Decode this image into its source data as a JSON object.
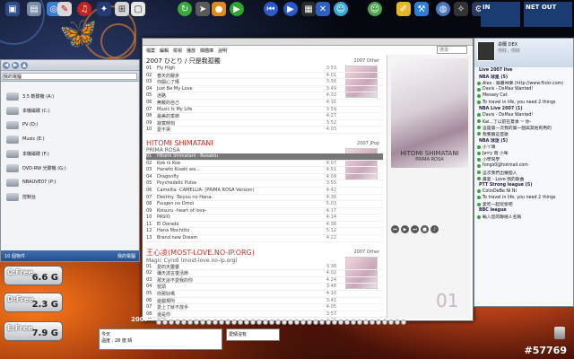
{
  "explorer": {
    "address": "我的電腦",
    "drives": [
      {
        "label": "3.5 軟碟機 (A:)"
      },
      {
        "label": "本機磁碟 (C:)"
      },
      {
        "label": "PV (D:)"
      },
      {
        "label": "Music (E:)"
      },
      {
        "label": "本機磁碟 (F:)"
      },
      {
        "label": "DVD-RW 光碟機 (G:)"
      },
      {
        "label": "NBAUVE07 (P:)"
      },
      {
        "label": "控制台"
      }
    ],
    "status_left": "10 個物件",
    "status_right": "我的電腦"
  },
  "gauges": [
    {
      "label": "C:Free",
      "value": "6.6 G"
    },
    {
      "label": "D:Free",
      "value": "2.3 G"
    },
    {
      "label": "E:Free",
      "value": "7.9 G"
    }
  ],
  "player": {
    "menu": [
      "檔案",
      "編輯",
      "檢視",
      "播放",
      "媒體庫",
      "說明"
    ],
    "search_placeholder": "搜尋",
    "albums": [
      {
        "title": "2007 ひとり / 只是我孤獨",
        "subtitle": "",
        "year": "2007 Other",
        "tracks": [
          {
            "n": "01",
            "title": "Fly High",
            "len": "3:53"
          },
          {
            "n": "02",
            "title": "春天的腳步",
            "len": "4:01"
          },
          {
            "n": "03",
            "title": "你開心了嗎",
            "len": "3:56"
          },
          {
            "n": "04",
            "title": "Just Be My Love",
            "len": "3:49"
          },
          {
            "n": "05",
            "title": "迷路",
            "len": "4:32"
          },
          {
            "n": "06",
            "title": "無敵的自己",
            "len": "4:15"
          },
          {
            "n": "07",
            "title": "Music Is My Life",
            "len": "3:59"
          },
          {
            "n": "08",
            "title": "最美的季節",
            "len": "4:27"
          },
          {
            "n": "09",
            "title": "寂寞時刻",
            "len": "3:52"
          },
          {
            "n": "10",
            "title": "愛不哭",
            "len": "4:03"
          }
        ]
      },
      {
        "title": "HITOMI SHIMATANI",
        "subtitle": "PRIMA ROSA",
        "year": "2007 JPop",
        "tracks": [
          {
            "n": "01",
            "title": "Hitomi Shimatani - Rosablu",
            "len": "4:28",
            "selected": true
          },
          {
            "n": "02",
            "title": "Koe ni Koe",
            "len": "4:07"
          },
          {
            "n": "03",
            "title": "Haneto Kiseki wa...",
            "len": "4:51"
          },
          {
            "n": "04",
            "title": "Dragonfly",
            "len": "4:09"
          },
          {
            "n": "05",
            "title": "Psychedelic Pulse",
            "len": "3:55"
          },
          {
            "n": "06",
            "title": "Camellia -CAMELLIA- (PRIMA ROSA Version)",
            "len": "4:42"
          },
          {
            "n": "07",
            "title": "Destiny -Taiyou no Hana-",
            "len": "4:36"
          },
          {
            "n": "08",
            "title": "Fuugen no Omoi",
            "len": "5:03"
          },
          {
            "n": "09",
            "title": "Koisuru -heart of love-",
            "len": "4:17"
          },
          {
            "n": "10",
            "title": "PASIO",
            "len": "4:14"
          },
          {
            "n": "11",
            "title": "El Dorado",
            "len": "4:38"
          },
          {
            "n": "12",
            "title": "Hana Mochitto",
            "len": "5:12"
          },
          {
            "n": "13",
            "title": "Brand new Dream",
            "len": "4:22"
          }
        ]
      },
      {
        "title": "王心凌(MOST-LOVE.NO-IP.ORG)",
        "subtitle": "Magic Cyndi (most-love.no-ip.org)",
        "year": "2007 Other",
        "tracks": [
          {
            "n": "01",
            "title": "愛的天靈靈",
            "len": "3:38"
          },
          {
            "n": "02",
            "title": "彌天謊言復活節",
            "len": "4:02"
          },
          {
            "n": "03",
            "title": "那天說不愛我的你",
            "len": "4:24"
          },
          {
            "n": "04",
            "title": "枕頭",
            "len": "3:48"
          },
          {
            "n": "05",
            "title": "你那好嗎",
            "len": "4:10"
          },
          {
            "n": "06",
            "title": "遊戲規則",
            "len": "3:41"
          },
          {
            "n": "07",
            "title": "愛上了就不放手",
            "len": "4:05"
          },
          {
            "n": "08",
            "title": "還是你",
            "len": "3:57"
          },
          {
            "n": "09",
            "title": "睡眠",
            "len": "4:31"
          },
          {
            "n": "10",
            "title": "天空很藍",
            "len": "3:36"
          }
        ]
      }
    ],
    "art_caption": "HITOMI SHIMATANI",
    "art_sub": "PRIMA ROSA",
    "track_number": "01"
  },
  "messenger": {
    "user": "卓爾 DEX",
    "status": "你好，你好",
    "search_placeholder": "輸入您的聯絡人名稱",
    "contacts": [
      {
        "name": "Live 2007 live",
        "group": true
      },
      {
        "name": "NBA 球星 (5)",
        "group": true
      },
      {
        "name": "Alex - 跟著林夢 (http://www.flickr.com)"
      },
      {
        "name": "Davis - DxMax Wanted!"
      },
      {
        "name": "Messey Cat"
      },
      {
        "name": "To travel in life, you need 2 things"
      },
      {
        "name": "NBA Live 2007 (1)",
        "group": true
      },
      {
        "name": "Davis - DxMax Wanted!"
      },
      {
        "name": "Kai...了以前在夏季 ~ 你-"
      },
      {
        "name": "這是第一次我的第一個與其他有用的"
      },
      {
        "name": "我要跟這首歌"
      },
      {
        "name": "NBA 球迷 (5)",
        "group": true
      },
      {
        "name": "小ㄚ頭"
      },
      {
        "name": "Jerry 雨 小咪"
      },
      {
        "name": "小學同學"
      },
      {
        "name": "fongs0@hotmail.com"
      },
      {
        "name": "這次我們出幾個人"
      },
      {
        "name": "最愛 - Love 我的歌曲"
      },
      {
        "name": "PTT Strong league (5)",
        "group": true
      },
      {
        "name": "ColinDeBe NI NI"
      },
      {
        "name": "To travel in life, you need 2 things"
      },
      {
        "name": "愛吃一起玩耍吧"
      },
      {
        "name": "BBC league",
        "group": true
      },
      {
        "name": "輸入您的聯絡人名稱"
      }
    ]
  },
  "tiles": [
    "IN",
    "NET OUT"
  ],
  "bottom": {
    "year_label": "2007",
    "note_line1": "今天",
    "note_line2": "溫度 : 28 度 晴",
    "note2": "愛晴沒有"
  },
  "watermark": "#57769",
  "colors": {
    "accent": "#c0302a",
    "selection": "#777777",
    "taskbar_blue": "#244f8e"
  }
}
